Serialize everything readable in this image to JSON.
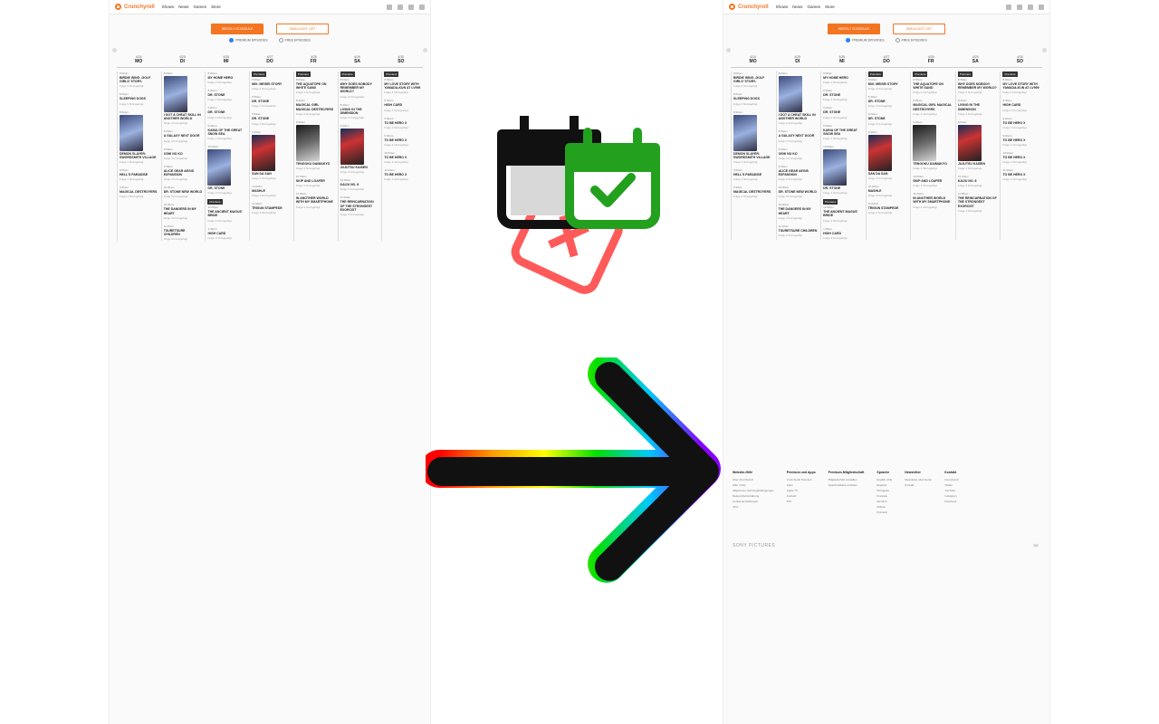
{
  "left": {
    "brand": "Crunchyroll",
    "nav": [
      "Shows",
      "News",
      "Games",
      "Store"
    ],
    "tabs": [
      "WEEKLY SCHEDULE",
      "SIMULCAST LIST"
    ],
    "radios": [
      "PREMIUM EPISODES",
      "FREE EPISODES"
    ],
    "days": [
      {
        "date": "4/24",
        "dow": "MO"
      },
      {
        "date": "4/25",
        "dow": "DI"
      },
      {
        "date": "4/26",
        "dow": "MI"
      },
      {
        "date": "4/27",
        "dow": "DO"
      },
      {
        "date": "4/28",
        "dow": "FR"
      },
      {
        "date": "4/29",
        "dow": "SA"
      },
      {
        "date": "4/30",
        "dow": "SO"
      }
    ],
    "columns": [
      [
        {
          "time": "8:00pm",
          "title": "BIRDIE WING -GOLF GIRLS' STORY-",
          "ep": "Folge 3 hinzugefügt"
        },
        {
          "time": "8:00pm",
          "title": "SLEEPING DOGS",
          "ep": "Folge 3 hinzugefügt"
        },
        {
          "time": "8:30pm",
          "title": "DEMON SLAYER: SWORDSMITH VILLAGE",
          "ep": "Folge 3 hinzugefügt",
          "poster": "a"
        },
        {
          "time": "9:00pm",
          "title": "HELL'S PARADISE",
          "ep": "Folge 4 hinzugefügt"
        },
        {
          "time": "9:30pm",
          "title": "MAGICAL DESTROYERS",
          "ep": "Folge 4 hinzugefügt"
        }
      ],
      [
        {
          "time": "8:00am",
          "title": "I GOT A CHEAT SKILL IN ANOTHER WORLD",
          "ep": "Folge 4 hinzugefügt",
          "poster": "a"
        },
        {
          "time": "8:30am",
          "title": "A GALAXY NEXT DOOR",
          "ep": "Folge 4 hinzugefügt"
        },
        {
          "time": "9:00am",
          "title": "OSHI NO KO",
          "ep": "Folge 4 hinzugefügt"
        },
        {
          "time": "9:30am",
          "title": "ALICE GEAR AEGIS EXPANSION",
          "ep": "Folge 4 hinzugefügt"
        },
        {
          "time": "10:00am",
          "title": "DR. STONE NEW WORLD",
          "ep": "Folge 3 hinzugefügt"
        },
        {
          "time": "10:30am",
          "title": "THE DANGERS IN MY HEART",
          "ep": "Folge 4 hinzugefügt"
        },
        {
          "time": "11:00am",
          "title": "TSURETSURE CHILDREN",
          "ep": "Folge 4 hinzugefügt"
        }
      ],
      [
        {
          "time": "8:00am",
          "title": "MY HOME HERO",
          "ep": "Folge 4 hinzugefügt"
        },
        {
          "time": "8:30am",
          "title": "DR. STONE",
          "ep": "Folge 4 hinzugefügt"
        },
        {
          "time": "9:00am",
          "title": "DR. STONE",
          "ep": "Folge 4 hinzugefügt"
        },
        {
          "time": "9:30am",
          "title": "KAINA OF THE GREAT SNOW SEA",
          "ep": "Folge 4 hinzugefügt"
        },
        {
          "time": "10:00am",
          "title": "DR. STONE",
          "ep": "Folge 4 hinzugefügt",
          "poster": "a"
        },
        {
          "time": "12:00pm",
          "title": "THE ANCIENT MAGUS' BRIDE",
          "ep": "Folge 4 hinzugefügt",
          "premiere": "Premiere"
        },
        {
          "time": "1:00pm",
          "title": "HIGH CARD",
          "ep": "Folge 4 hinzugefügt"
        }
      ],
      [
        {
          "time": "8:00am",
          "title": "MIX: MEISEI STORY",
          "ep": "Folge 4 hinzugefügt",
          "premiere": "Premiere"
        },
        {
          "time": "8:30am",
          "title": "DR. STONE",
          "ep": "Folge 4 hinzugefügt"
        },
        {
          "time": "9:00am",
          "title": "DR. STONE",
          "ep": "Folge 4 hinzugefügt"
        },
        {
          "time": "9:30am",
          "title": "SAN DA SAN",
          "ep": "Folge 4 hinzugefügt",
          "poster": "c"
        },
        {
          "time": "10:00am",
          "title": "MASHLE",
          "ep": "Folge 4 hinzugefügt"
        },
        {
          "time": "11:00am",
          "title": "TRIGUN STAMPEDE",
          "ep": "Folge 4 hinzugefügt"
        }
      ],
      [
        {
          "time": "8:00am",
          "title": "THE AQUATOPE ON WHITE SAND",
          "ep": "Folge 4 hinzugefügt",
          "premiere": "Premiere"
        },
        {
          "time": "8:30am",
          "title": "MAGICAL GIRL MAGICAL DESTROYERS",
          "ep": "Folge 4 hinzugefügt"
        },
        {
          "time": "9:00am",
          "title": "TENGOKU DAIMAKYO",
          "ep": "Folge 4 hinzugefügt",
          "poster": "b"
        },
        {
          "time": "10:00am",
          "title": "SKIP AND LOAFER",
          "ep": "Folge 4 hinzugefügt"
        },
        {
          "time": "11:00am",
          "title": "IN ANOTHER WORLD WITH MY SMARTPHONE",
          "ep": "Folge 4 hinzugefügt"
        }
      ],
      [
        {
          "time": "8:00am",
          "title": "WHY DOES NOBODY REMEMBER MY WORLD?",
          "ep": "Folge 4 hinzugefügt",
          "premiere": "Premiere"
        },
        {
          "time": "8:30am",
          "title": "LIVING IN THE DIMENSION",
          "ep": "Folge 4 hinzugefügt"
        },
        {
          "time": "9:00am",
          "title": "JUJUTSU KAISEN",
          "ep": "Folge 4 hinzugefügt",
          "poster": "c"
        },
        {
          "time": "10:00am",
          "title": "KAIJU NO. 8",
          "ep": "Folge 4 hinzugefügt"
        },
        {
          "time": "11:00am",
          "title": "THE REINCARNATION OF THE STRONGEST EXORCIST",
          "ep": "Folge 4 hinzugefügt"
        }
      ],
      [
        {
          "time": "8:00am",
          "title": "MY LOVE STORY WITH YAMADA-KUN AT LV999",
          "ep": "Folge 4 hinzugefügt",
          "premiere": "Premiere"
        },
        {
          "time": "8:30am",
          "title": "HIGH CARD",
          "ep": "Folge 4 hinzugefügt"
        },
        {
          "time": "9:00am",
          "title": "TO BE HERO X",
          "ep": "Folge 4 hinzugefügt"
        },
        {
          "time": "9:30am",
          "title": "TO BE HERO X",
          "ep": "Folge 4 hinzugefügt"
        },
        {
          "time": "10:00am",
          "title": "TO BE HERO X",
          "ep": "Folge 4 hinzugefügt"
        },
        {
          "time": "11:00am",
          "title": "TO BE HERO X",
          "ep": "Folge 4 hinzugefügt"
        }
      ]
    ]
  },
  "right": {
    "brand": "Crunchyroll",
    "nav": [
      "Shows",
      "News",
      "Games",
      "Store"
    ],
    "tabs": [
      "WEEKLY SCHEDULE",
      "SIMULCAST LIST"
    ],
    "radios": [
      "PREMIUM EPISODES",
      "FREE EPISODES"
    ],
    "footer": [
      {
        "heading": "Website-Hilfe",
        "links": [
          "Über Crunchyroll",
          "Hilfe / FAQ",
          "Allgemeine Nutzungsbedingungen",
          "Datenschutzerklärung",
          "Cookie-Einstellungen",
          "Jobs"
        ]
      },
      {
        "heading": "Premium und Apps",
        "links": [
          "Crunchyroll Premium",
          "Apps",
          "Apple TV",
          "Android",
          "iOS"
        ]
      },
      {
        "heading": "Premium-Mitgliedschaft",
        "links": [
          "Mitgliedschaft verwalten",
          "Geschenkkarte einlösen"
        ]
      },
      {
        "heading": "Sprache",
        "links": [
          "English (US)",
          "Español",
          "Português",
          "Français",
          "Deutsch",
          "Italiano",
          "Русский"
        ]
      },
      {
        "heading": "Newsletter",
        "links": [
          "Newsletter abonnieren",
          "Kontakt"
        ]
      },
      {
        "heading": "Kontakt",
        "links": [
          "Crunchyroll",
          "Twitter",
          "YouTube",
          "Instagram",
          "Facebook"
        ]
      }
    ],
    "sony": "SONY PICTURES",
    "lang": "DE"
  },
  "colors": {
    "accent": "#f47521",
    "calendar_green": "#22a01e",
    "calendar_red": "#ff5a5a"
  }
}
